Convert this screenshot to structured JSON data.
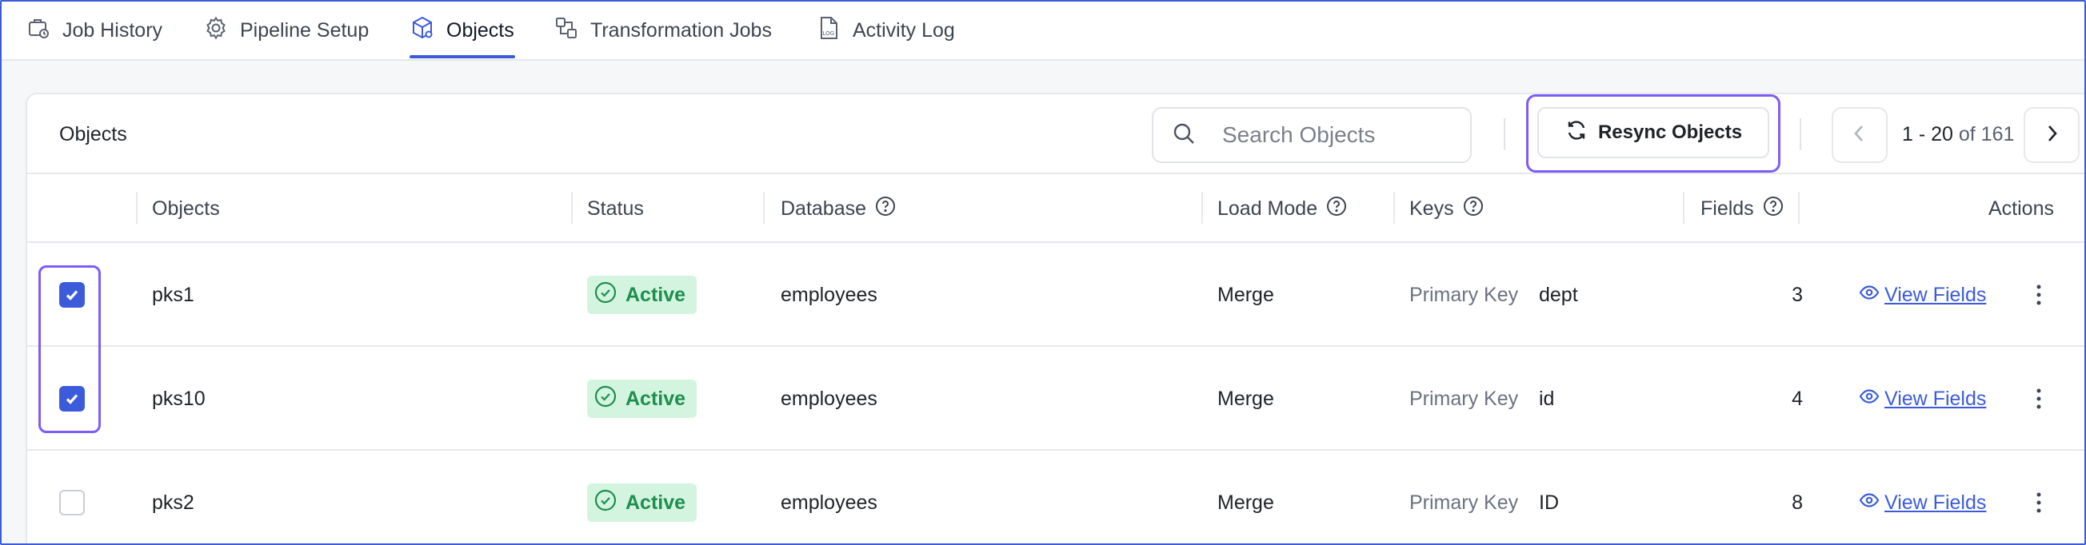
{
  "tabs": [
    {
      "label": "Job History",
      "icon": "job-history-icon"
    },
    {
      "label": "Pipeline Setup",
      "icon": "gear-icon"
    },
    {
      "label": "Objects",
      "icon": "cube-icon",
      "active": true
    },
    {
      "label": "Transformation Jobs",
      "icon": "transform-icon"
    },
    {
      "label": "Activity Log",
      "icon": "log-file-icon"
    }
  ],
  "toolbar": {
    "title": "Objects",
    "search_placeholder": "Search Objects",
    "resync_label": "Resync Objects",
    "pagination": {
      "range": "1 - 20",
      "of_label": "of 161"
    }
  },
  "table": {
    "columns": [
      "Objects",
      "Status",
      "Database",
      "Load Mode",
      "Keys",
      "Fields",
      "Actions"
    ],
    "rows": [
      {
        "checked": true,
        "object": "pks1",
        "status": "Active",
        "database": "employees",
        "load_mode": "Merge",
        "key_type": "Primary Key",
        "key": "dept",
        "fields": "3",
        "action": "View Fields"
      },
      {
        "checked": true,
        "object": "pks10",
        "status": "Active",
        "database": "employees",
        "load_mode": "Merge",
        "key_type": "Primary Key",
        "key": "id",
        "fields": "4",
        "action": "View Fields"
      },
      {
        "checked": false,
        "object": "pks2",
        "status": "Active",
        "database": "employees",
        "load_mode": "Merge",
        "key_type": "Primary Key",
        "key": "ID",
        "fields": "8",
        "action": "View Fields"
      }
    ]
  },
  "colors": {
    "accent": "#3b5bdb",
    "highlight_ring": "#7c5cfa",
    "status_bg": "#d3f5df",
    "status_text": "#1e8e4e"
  }
}
